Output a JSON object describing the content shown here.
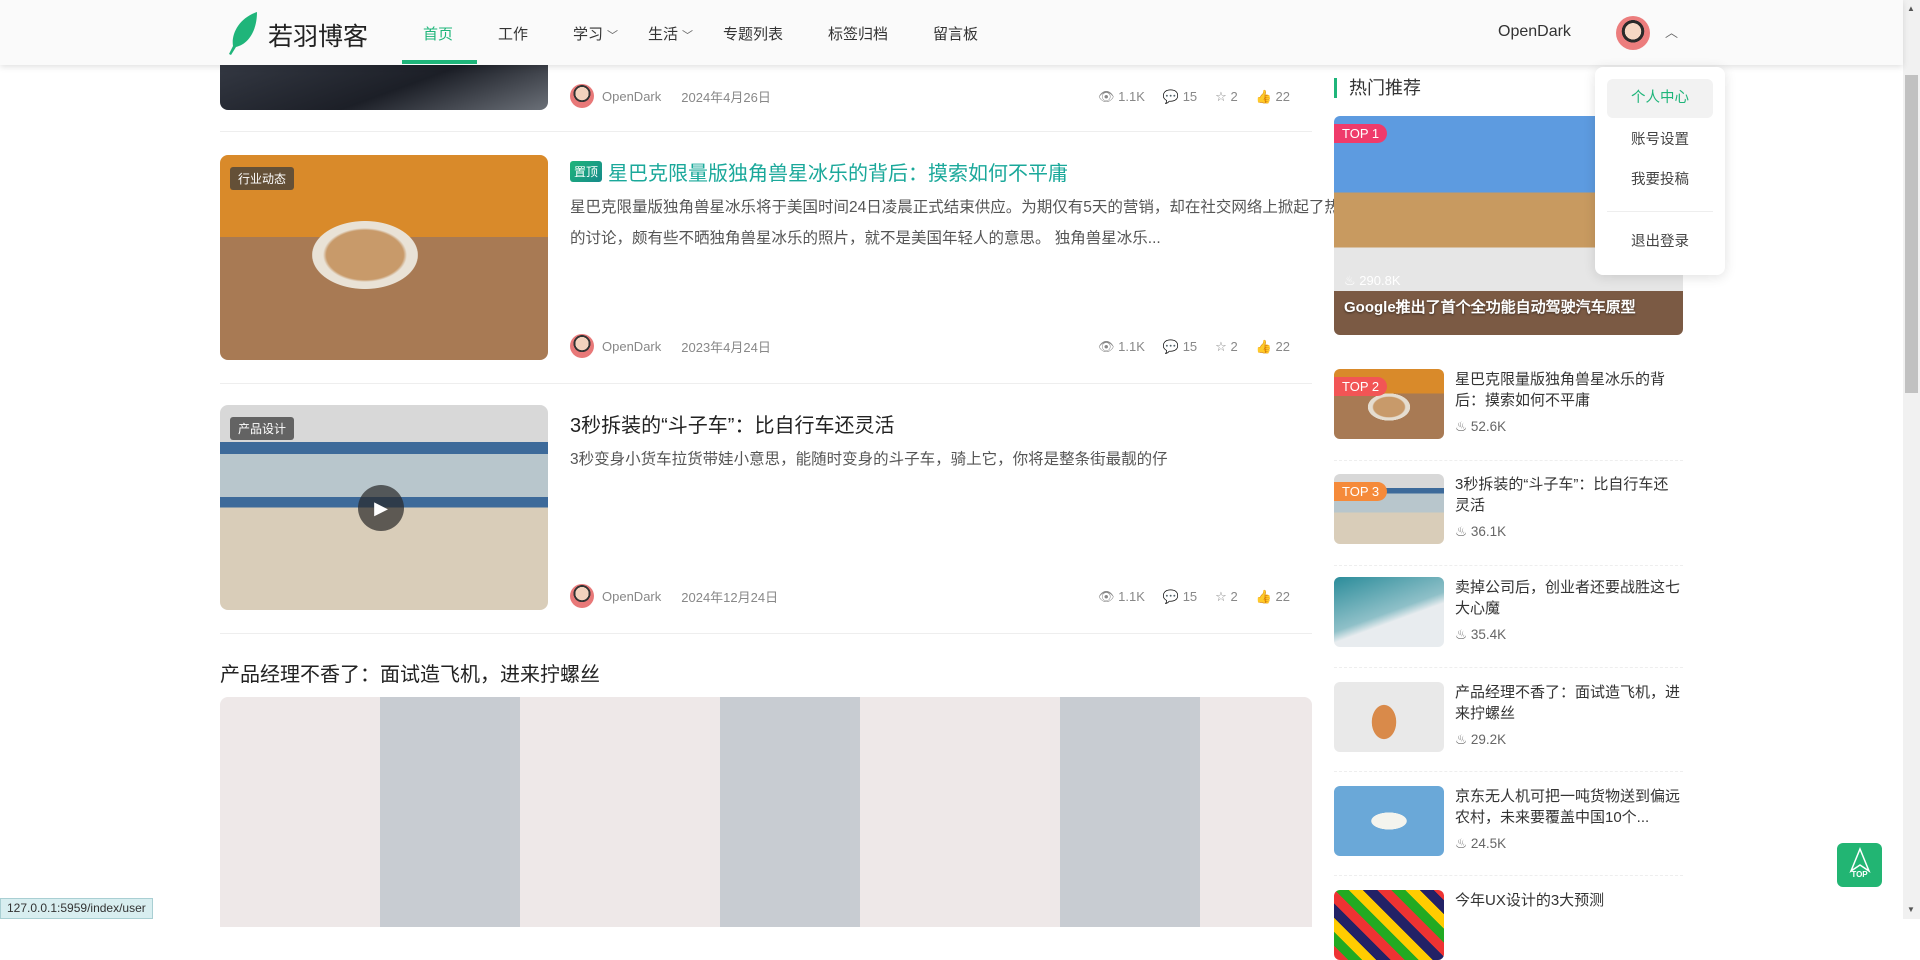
{
  "header": {
    "site_name": "若羽博客",
    "nav": [
      {
        "label": "首页",
        "active": true
      },
      {
        "label": "工作"
      },
      {
        "label": "学习",
        "dropdown": true
      },
      {
        "label": "生活",
        "dropdown": true
      },
      {
        "label": "专题列表"
      },
      {
        "label": "标签归档"
      },
      {
        "label": "留言板"
      }
    ],
    "username": "OpenDark",
    "accent": "#1fb57a"
  },
  "user_menu": {
    "items": [
      "个人中心",
      "账号设置",
      "我要投稿",
      "退出登录"
    ],
    "active": "个人中心"
  },
  "articles": [
    {
      "author": "OpenDark",
      "date": "2024年4月26日",
      "views": "1.1K",
      "comments": "15",
      "stars": "2",
      "likes": "22"
    },
    {
      "tag": "行业动态",
      "pinned": "置顶",
      "title": "星巴克限量版独角兽星冰乐的背后：摸索如何不平庸",
      "summary": "星巴克限量版独角兽星冰乐将于美国时间24日凌晨正式结束供应。为期仅有5天的营销，却在社交网络上掀起了热烈的讨论，颇有些不晒独角兽星冰乐的照片，就不是美国年轻人的意思。 独角兽星冰乐...",
      "author": "OpenDark",
      "date": "2023年4月24日",
      "views": "1.1K",
      "comments": "15",
      "stars": "2",
      "likes": "22"
    },
    {
      "tag": "产品设计",
      "title": "3秒拆装的“斗子车”：比自行车还灵活",
      "summary": "3秒变身小货车拉货带娃小意思，能随时变身的斗子车，骑上它，你将是整条街最靓的仔",
      "author": "OpenDark",
      "date": "2024年12月24日",
      "views": "1.1K",
      "comments": "15",
      "stars": "2",
      "likes": "22"
    },
    {
      "title": "产品经理不香了：面试造飞机，进来拧螺丝"
    }
  ],
  "sidebar": {
    "title": "热门推荐",
    "top": {
      "badge": "TOP 1",
      "hot": "290.8K",
      "title": "Google推出了首个全功能自动驾驶汽车原型"
    },
    "items": [
      {
        "badge": "TOP 2",
        "badge_color": "#f25555",
        "title": "星巴克限量版独角兽星冰乐的背后：摸索如何不平庸",
        "hot": "52.6K"
      },
      {
        "badge": "TOP 3",
        "badge_color": "#f58a3a",
        "title": "3秒拆装的“斗子车”：比自行车还灵活",
        "hot": "36.1K"
      },
      {
        "title": "卖掉公司后，创业者还要战胜这七大心魔",
        "hot": "35.4K"
      },
      {
        "title": "产品经理不香了：面试造飞机，进来拧螺丝",
        "hot": "29.2K"
      },
      {
        "title": "京东无人机可把一吨货物送到偏远农村，未来要覆盖中国10个...",
        "hot": "24.5K"
      },
      {
        "title": "今年UX设计的3大预测"
      }
    ]
  },
  "back_to_top": "TOP",
  "status_url": "127.0.0.1:5959/index/user"
}
